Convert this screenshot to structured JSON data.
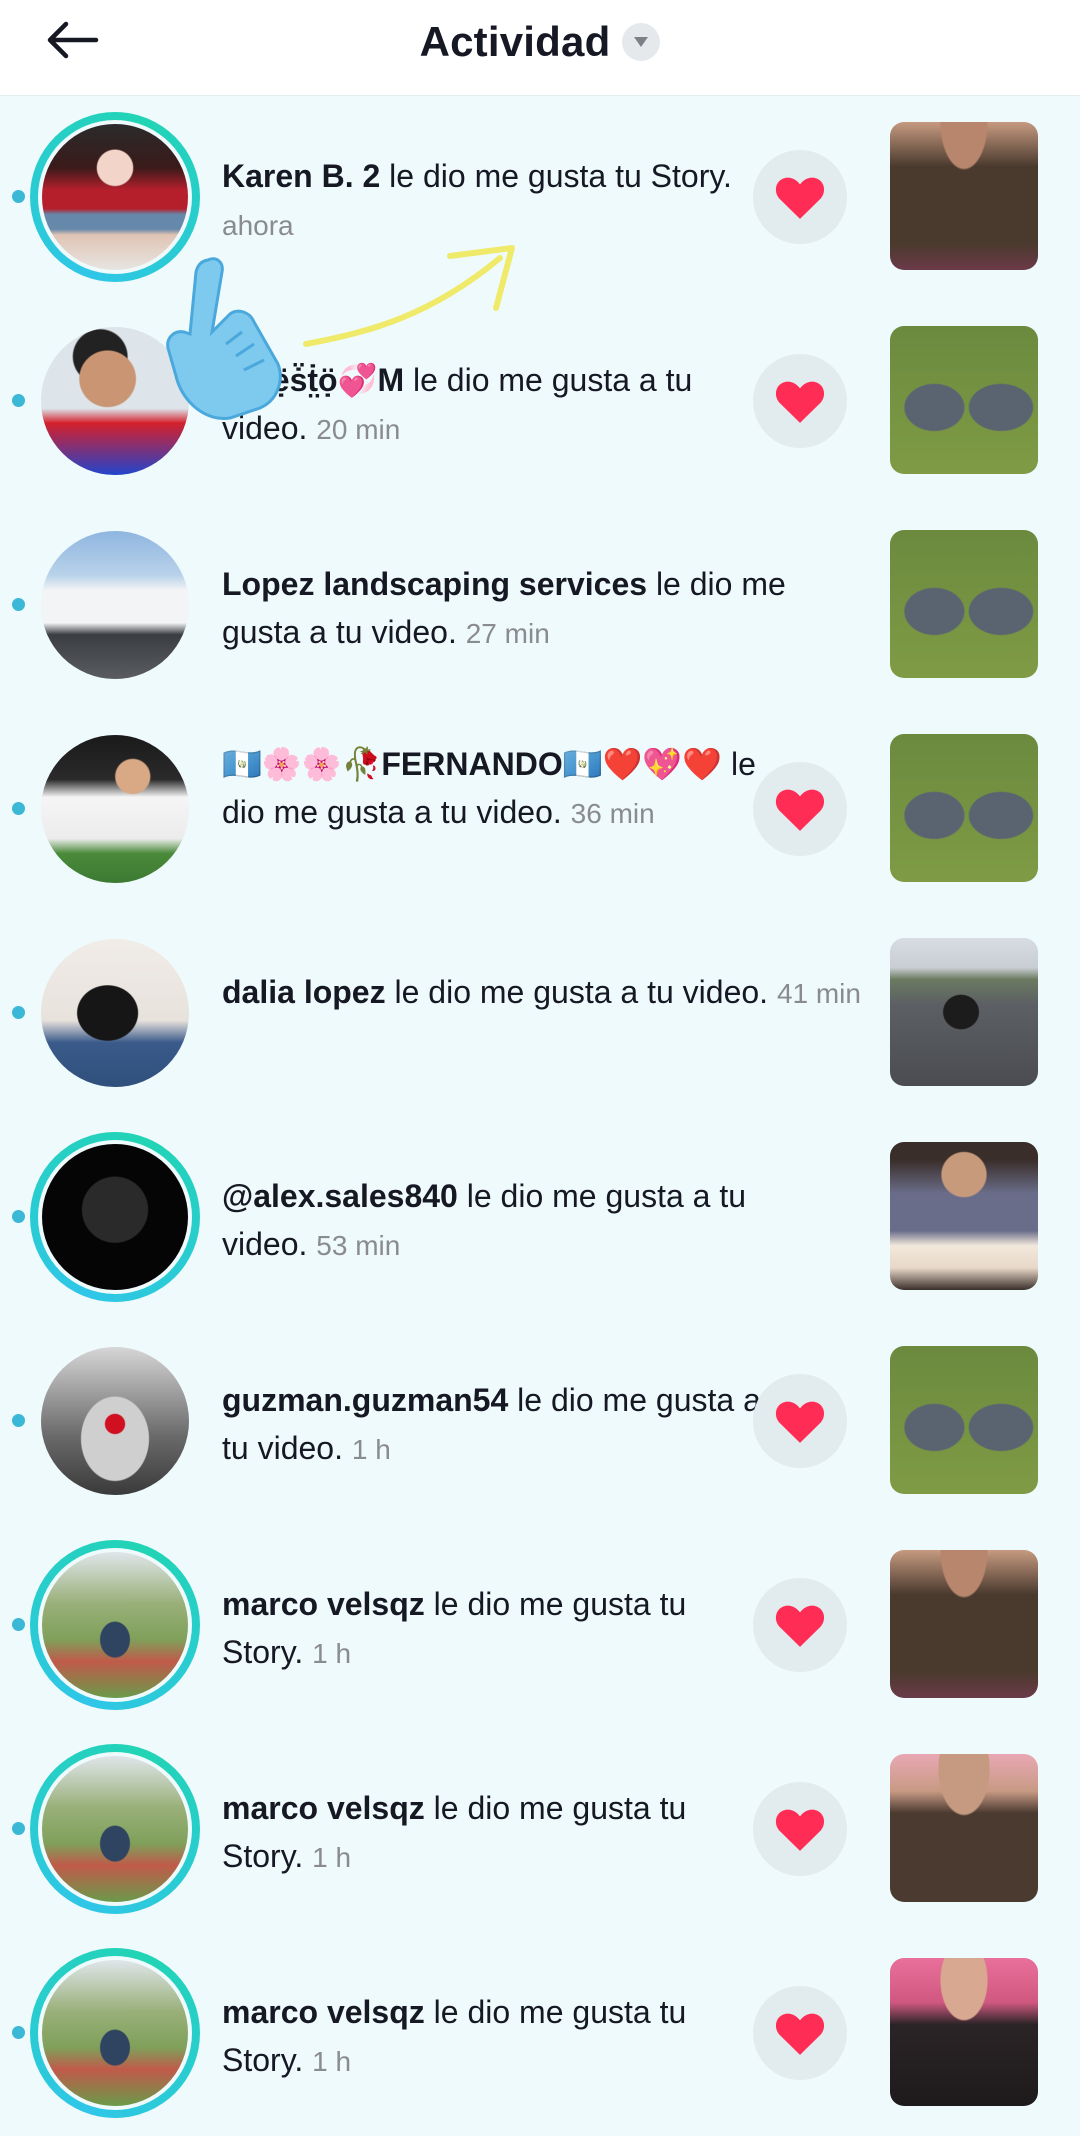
{
  "header": {
    "title": "Actividad",
    "back_icon": "arrow-left-icon",
    "dropdown_icon": "caret-down-icon"
  },
  "colors": {
    "background": "#eefafc",
    "ring_gradient": "#2fc6e8",
    "unread_dot": "#3ab8d6",
    "heart": "#ff2c55",
    "time_text": "#8a8b91"
  },
  "items": [
    {
      "user": "Karen B. 2",
      "action": " le dio me gusta tu Story.",
      "time": "ahora",
      "has_like": true,
      "story": true
    },
    {
      "user": "ẹ̈ṛṇẹ̈ṡ̈ṫ̤ọ̈💞M",
      "action": " le dio me gusta a tu video.",
      "time": "20 min",
      "has_like": true,
      "story": false
    },
    {
      "user": "Lopez landscaping services",
      "action": " le dio me gusta a tu video.",
      "time": "27 min",
      "has_like": true,
      "story": false
    },
    {
      "user": "🇬🇹🌸🌸🥀FERNANDO🇬🇹❤️💖❤️",
      "action": " le dio me gusta a tu video.",
      "time": "36 min",
      "has_like": true,
      "story": false
    },
    {
      "user": "dalia lopez",
      "action": " le dio me gusta a tu video.",
      "time": "41 min",
      "has_like": false,
      "story": false
    },
    {
      "user": "@alex.sales840",
      "action": " le dio me gusta a tu video.",
      "time": "53 min",
      "has_like": false,
      "story": true
    },
    {
      "user": "guzman.guzman54",
      "action": " le dio me gusta a tu video.",
      "time": "1 h",
      "has_like": true,
      "story": false
    },
    {
      "user": "marco  velsqz",
      "action": " le dio me gusta tu Story.",
      "time": "1 h",
      "has_like": true,
      "story": true
    },
    {
      "user": "marco  velsqz",
      "action": " le dio me gusta tu Story.",
      "time": "1 h",
      "has_like": true,
      "story": true
    },
    {
      "user": "marco  velsqz",
      "action": " le dio me gusta tu Story.",
      "time": "1 h",
      "has_like": true,
      "story": true
    }
  ]
}
